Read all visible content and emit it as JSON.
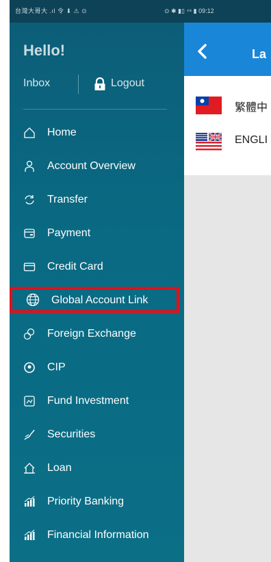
{
  "status_bar": {
    "left": "台灣大哥大 .ıl 令 ⬇ ⚠ ⊙",
    "right": "⊙ ✱ ▮▯ ⁴⁸ ▮ 09:12"
  },
  "drawer": {
    "greeting": "Hello!",
    "inbox_label": "Inbox",
    "logout_label": "Logout",
    "menu": [
      {
        "label": "Home",
        "icon": "home-icon"
      },
      {
        "label": "Account Overview",
        "icon": "person-icon"
      },
      {
        "label": "Transfer",
        "icon": "transfer-icon"
      },
      {
        "label": "Payment",
        "icon": "payment-icon"
      },
      {
        "label": "Credit Card",
        "icon": "credit-card-icon"
      },
      {
        "label": "Global Account Link",
        "icon": "globe-icon"
      },
      {
        "label": "Foreign Exchange",
        "icon": "exchange-icon"
      },
      {
        "label": "CIP",
        "icon": "cip-icon"
      },
      {
        "label": "Fund Investment",
        "icon": "fund-icon"
      },
      {
        "label": "Securities",
        "icon": "securities-icon"
      },
      {
        "label": "Loan",
        "icon": "loan-icon"
      },
      {
        "label": "Priority Banking",
        "icon": "chart-icon"
      },
      {
        "label": "Financial Information",
        "icon": "chart-icon"
      }
    ],
    "highlight_color": "#e0111b"
  },
  "content": {
    "title": "La",
    "languages": [
      {
        "label": "繁體中",
        "flag": "taiwan-flag-icon"
      },
      {
        "label": "ENGLI",
        "flag": "uk-flag-icon"
      }
    ],
    "header_color": "#1a86d8"
  }
}
